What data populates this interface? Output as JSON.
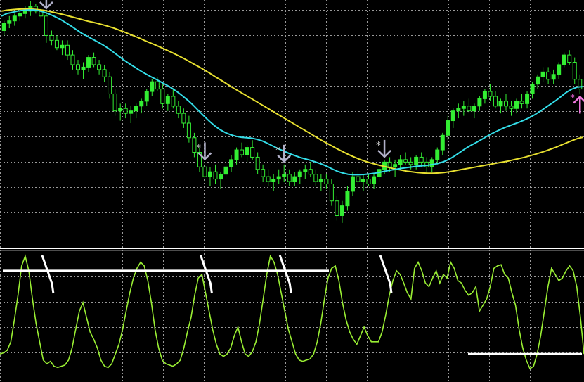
{
  "colors": {
    "background": "#000000",
    "grid": "#9a9a9a",
    "separator": "#ffffff",
    "bull_candle": "#33ee33",
    "bear_candle": "#000000",
    "wick": "#33ee33",
    "ma_fast": "#33dde8",
    "ma_slow": "#e8e030",
    "sell_arrow": "#b0b0c8",
    "buy_arrow": "#ee77dd",
    "star_sell": "#d8d8d8",
    "star_buy": "#ee66dd",
    "oscillator": "#99ee33",
    "level_line": "#ffffff",
    "signal_mark": "#ffffff"
  },
  "chart_data": [
    {
      "type": "candlestick",
      "grid": true,
      "ylim": [
        0,
        100
      ],
      "candles": [
        [
          88,
          92,
          86,
          91
        ],
        [
          91,
          94,
          89,
          92
        ],
        [
          92,
          95,
          90,
          94
        ],
        [
          94,
          97,
          92,
          95
        ],
        [
          95,
          98,
          93,
          96
        ],
        [
          96,
          100,
          94,
          98
        ],
        [
          98,
          99,
          95,
          96
        ],
        [
          96,
          97,
          93,
          94
        ],
        [
          94,
          96,
          83,
          86
        ],
        [
          86,
          88,
          82,
          84
        ],
        [
          84,
          86,
          80,
          81
        ],
        [
          81,
          84,
          78,
          82
        ],
        [
          82,
          84,
          76,
          78
        ],
        [
          78,
          80,
          72,
          74
        ],
        [
          74,
          76,
          70,
          72
        ],
        [
          72,
          75,
          68,
          73
        ],
        [
          73,
          78,
          71,
          77
        ],
        [
          77,
          79,
          73,
          74
        ],
        [
          74,
          76,
          70,
          72
        ],
        [
          72,
          74,
          67,
          69
        ],
        [
          69,
          71,
          60,
          62
        ],
        [
          62,
          64,
          53,
          55
        ],
        [
          55,
          58,
          51,
          56
        ],
        [
          56,
          58,
          52,
          54
        ],
        [
          54,
          57,
          50,
          55
        ],
        [
          55,
          58,
          52,
          57
        ],
        [
          57,
          60,
          54,
          59
        ],
        [
          59,
          64,
          57,
          63
        ],
        [
          63,
          68,
          61,
          67
        ],
        [
          67,
          69,
          63,
          64
        ],
        [
          64,
          66,
          56,
          58
        ],
        [
          58,
          62,
          55,
          61
        ],
        [
          61,
          64,
          56,
          57
        ],
        [
          57,
          59,
          52,
          54
        ],
        [
          54,
          56,
          48,
          50
        ],
        [
          50,
          53,
          42,
          44
        ],
        [
          44,
          46,
          36,
          38
        ],
        [
          38,
          40,
          30,
          32
        ],
        [
          32,
          34,
          26,
          28
        ],
        [
          28,
          32,
          24,
          30
        ],
        [
          30,
          33,
          25,
          27
        ],
        [
          27,
          30,
          23,
          29
        ],
        [
          29,
          33,
          27,
          32
        ],
        [
          32,
          37,
          30,
          35
        ],
        [
          35,
          40,
          33,
          39
        ],
        [
          39,
          42,
          36,
          37
        ],
        [
          37,
          41,
          34,
          40
        ],
        [
          40,
          43,
          35,
          36
        ],
        [
          36,
          38,
          29,
          31
        ],
        [
          31,
          33,
          26,
          28
        ],
        [
          28,
          31,
          24,
          26
        ],
        [
          26,
          29,
          22,
          27
        ],
        [
          27,
          31,
          25,
          28
        ],
        [
          28,
          33,
          26,
          29
        ],
        [
          29,
          31,
          24,
          26
        ],
        [
          26,
          30,
          24,
          28
        ],
        [
          28,
          31,
          25,
          30
        ],
        [
          30,
          33,
          27,
          31
        ],
        [
          31,
          34,
          28,
          29
        ],
        [
          29,
          31,
          24,
          26
        ],
        [
          26,
          29,
          22,
          27
        ],
        [
          27,
          29,
          23,
          25
        ],
        [
          25,
          27,
          16,
          18
        ],
        [
          18,
          20,
          10,
          12
        ],
        [
          12,
          18,
          9,
          16
        ],
        [
          16,
          24,
          14,
          22
        ],
        [
          22,
          30,
          20,
          28
        ],
        [
          28,
          32,
          24,
          26
        ],
        [
          26,
          29,
          22,
          27
        ],
        [
          27,
          29,
          24,
          25
        ],
        [
          25,
          29,
          23,
          28
        ],
        [
          28,
          32,
          26,
          31
        ],
        [
          31,
          35,
          29,
          34
        ],
        [
          34,
          36,
          30,
          32
        ],
        [
          32,
          35,
          28,
          33
        ],
        [
          33,
          37,
          31,
          35
        ],
        [
          35,
          38,
          33,
          34
        ],
        [
          34,
          36,
          31,
          33
        ],
        [
          33,
          37,
          31,
          36
        ],
        [
          36,
          38,
          32,
          34
        ],
        [
          34,
          36,
          30,
          32
        ],
        [
          32,
          36,
          30,
          35
        ],
        [
          35,
          40,
          33,
          39
        ],
        [
          39,
          46,
          37,
          45
        ],
        [
          45,
          53,
          43,
          51
        ],
        [
          51,
          56,
          48,
          55
        ],
        [
          55,
          58,
          52,
          56
        ],
        [
          56,
          59,
          53,
          57
        ],
        [
          57,
          60,
          54,
          55
        ],
        [
          55,
          58,
          52,
          57
        ],
        [
          57,
          61,
          55,
          60
        ],
        [
          60,
          64,
          58,
          63
        ],
        [
          63,
          66,
          59,
          61
        ],
        [
          61,
          63,
          56,
          57
        ],
        [
          57,
          60,
          54,
          59
        ],
        [
          59,
          62,
          55,
          57
        ],
        [
          57,
          59,
          53,
          56
        ],
        [
          56,
          60,
          54,
          59
        ],
        [
          59,
          62,
          56,
          58
        ],
        [
          58,
          63,
          56,
          62
        ],
        [
          62,
          67,
          60,
          66
        ],
        [
          66,
          70,
          64,
          69
        ],
        [
          69,
          73,
          67,
          71
        ],
        [
          71,
          73,
          66,
          68
        ],
        [
          68,
          72,
          66,
          70
        ],
        [
          70,
          75,
          68,
          74
        ],
        [
          74,
          79,
          73,
          78
        ],
        [
          78,
          80,
          74,
          75
        ],
        [
          75,
          77,
          66,
          68
        ],
        [
          68,
          70,
          62,
          64
        ]
      ],
      "ma_fast": [
        94,
        95,
        95.5,
        96,
        96.3,
        96.5,
        96.5,
        96.2,
        95.6,
        94.8,
        93.8,
        92.7,
        91.4,
        90,
        88.5,
        87,
        85.8,
        84.6,
        83.4,
        82.2,
        80.8,
        79.2,
        77.5,
        75.9,
        74.4,
        73,
        71.6,
        70.3,
        69.1,
        68,
        66.8,
        65.6,
        64.3,
        62.8,
        61.1,
        59.3,
        57.3,
        55.1,
        52.9,
        50.8,
        48.9,
        47.3,
        46.1,
        45.2,
        44.6,
        44.2,
        44,
        43.8,
        43.3,
        42.6,
        41.6,
        40.5,
        39.4,
        38.5,
        37.5,
        36.7,
        35.9,
        35.3,
        34.7,
        34,
        33.2,
        32.3,
        31.2,
        30.2,
        29.5,
        29,
        28.8,
        28.8,
        28.9,
        29.1,
        29.4,
        29.8,
        30.3,
        30.7,
        31,
        31.4,
        31.7,
        32,
        32.3,
        32.5,
        32.7,
        33,
        33.5,
        34.2,
        35.2,
        36.5,
        38,
        39.5,
        40.8,
        42,
        43.2,
        44.5,
        45.7,
        46.8,
        47.8,
        48.7,
        49.5,
        50.3,
        51.2,
        52.2,
        53.4,
        54.8,
        56.3,
        57.8,
        59.3,
        61,
        62.7,
        64,
        64.8,
        65
      ],
      "ma_slow": [
        96,
        96.4,
        96.6,
        96.8,
        96.9,
        96.9,
        96.8,
        96.6,
        96.3,
        95.9,
        95.4,
        94.9,
        94.4,
        93.8,
        93.2,
        92.6,
        92,
        91.5,
        91,
        90.4,
        89.8,
        89.1,
        88.3,
        87.5,
        86.6,
        85.7,
        84.8,
        83.8,
        82.9,
        82,
        81,
        80,
        79,
        77.9,
        76.8,
        75.6,
        74.4,
        73.2,
        71.9,
        70.6,
        69.2,
        67.9,
        66.5,
        65.1,
        63.8,
        62.5,
        61.2,
        59.9,
        58.6,
        57.3,
        56,
        54.7,
        53.4,
        52.1,
        50.8,
        49.5,
        48.2,
        46.9,
        45.6,
        44.3,
        43,
        41.8,
        40.6,
        39.4,
        38.3,
        37.2,
        36.2,
        35.3,
        34.5,
        33.8,
        33.2,
        32.6,
        32.1,
        31.6,
        31.1,
        30.7,
        30.3,
        30,
        29.7,
        29.5,
        29.4,
        29.4,
        29.5,
        29.7,
        30,
        30.4,
        30.8,
        31.2,
        31.6,
        32,
        32.4,
        32.8,
        33.2,
        33.6,
        34,
        34.4,
        34.9,
        35.4,
        35.9,
        36.5,
        37.1,
        37.8,
        38.5,
        39.3,
        40.1,
        41,
        41.9,
        42.8,
        43.6,
        44.2
      ],
      "signals": [
        {
          "kind": "sell",
          "index": 8
        },
        {
          "kind": "sell",
          "index": 38
        },
        {
          "kind": "sell",
          "index": 53
        },
        {
          "kind": "sell",
          "index": 72
        },
        {
          "kind": "buy",
          "index": 128
        }
      ]
    },
    {
      "type": "line",
      "grid": true,
      "ylim": [
        0,
        100
      ],
      "values": [
        20,
        21,
        23,
        30,
        48,
        68,
        92,
        100,
        88,
        65,
        45,
        30,
        15,
        12,
        14,
        10,
        9,
        10,
        11,
        15,
        25,
        40,
        55,
        62,
        50,
        38,
        32,
        25,
        15,
        10,
        9,
        12,
        20,
        28,
        40,
        55,
        70,
        82,
        90,
        95,
        92,
        80,
        62,
        40,
        25,
        15,
        12,
        11,
        10,
        12,
        15,
        25,
        38,
        50,
        68,
        82,
        85,
        70,
        55,
        40,
        28,
        20,
        18,
        20,
        25,
        35,
        42,
        30,
        20,
        18,
        22,
        30,
        45,
        65,
        85,
        100,
        95,
        85,
        70,
        55,
        40,
        30,
        20,
        15,
        14,
        15,
        16,
        20,
        30,
        45,
        65,
        82,
        90,
        92,
        80,
        62,
        48,
        38,
        32,
        28,
        35,
        42,
        35,
        30,
        30,
        30,
        38,
        52,
        68,
        80,
        88,
        85,
        78,
        70,
        65,
        90,
        95,
        88,
        78,
        75,
        82,
        88,
        78,
        85,
        82,
        95,
        90,
        80,
        78,
        72,
        68,
        70,
        75,
        55,
        60,
        65,
        75,
        90,
        92,
        93,
        85,
        82,
        70,
        60,
        40,
        25,
        15,
        8,
        10,
        20,
        35,
        55,
        75,
        90,
        85,
        80,
        82,
        88,
        92,
        88,
        75,
        50,
        20
      ],
      "level_upper": 88,
      "level_lower": 20
    }
  ]
}
